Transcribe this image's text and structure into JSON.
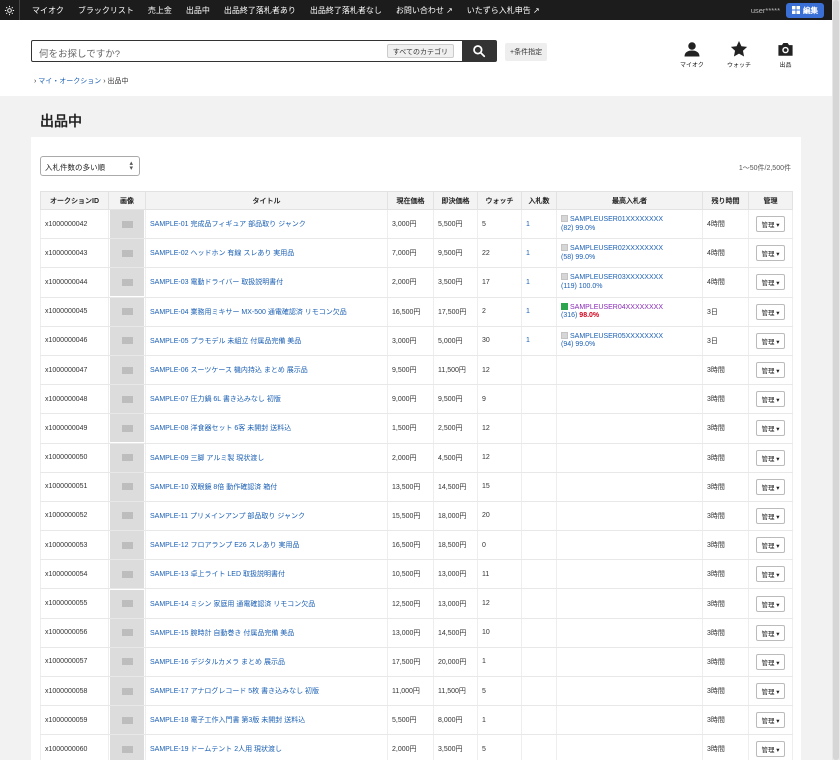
{
  "topbar": {
    "nav": [
      "マイオク",
      "ブラックリスト",
      "売上金",
      "出品中",
      "出品終了落札者あり",
      "出品終了落札者なし",
      "お問い合わせ ↗",
      "いたずら入札申告 ↗"
    ],
    "user": "user*****",
    "edit_label": "編集"
  },
  "search": {
    "placeholder": "何をお探しですか?",
    "category": "すべてのカテゴリ",
    "filter_label": "+条件指定"
  },
  "header_icons": [
    {
      "label": "マイオク",
      "icon": "user-icon"
    },
    {
      "label": "ウォッチ",
      "icon": "star-icon"
    },
    {
      "label": "出品",
      "icon": "camera-icon"
    }
  ],
  "breadcrumb": {
    "parent": "マイ・オークション",
    "sep": "›",
    "current": "出品中"
  },
  "page_title": "出品中",
  "sort_label": "入札件数の多い順",
  "count_label": "1〜50件/2,500件",
  "columns": [
    "オークションID",
    "画像",
    "タイトル",
    "現在価格",
    "即決価格",
    "ウォッチ",
    "入札数",
    "最高入札者",
    "残り時間",
    "管理"
  ],
  "manage_label": "管理 ▾",
  "rows": [
    {
      "id": "x1000000042",
      "title": "SAMPLE-01 完成品フィギュア 部品取り ジャンク",
      "price": "3,000円",
      "buyout": "5,500円",
      "watch": "5",
      "bids": "1",
      "bidder": "SAMPLEUSER01XXXXXXXX",
      "rating": "(82) 99.0%",
      "checked": false,
      "time": "4時間"
    },
    {
      "id": "x1000000043",
      "title": "SAMPLE-02 ヘッドホン 有線 スレあり 実用品",
      "price": "7,000円",
      "buyout": "9,500円",
      "watch": "22",
      "bids": "1",
      "bidder": "SAMPLEUSER02XXXXXXXX",
      "rating": "(58) 99.0%",
      "checked": false,
      "time": "4時間"
    },
    {
      "id": "x1000000044",
      "title": "SAMPLE-03 電動ドライバー 取扱説明書付",
      "price": "2,000円",
      "buyout": "3,500円",
      "watch": "17",
      "bids": "1",
      "bidder": "SAMPLEUSER03XXXXXXXX",
      "rating": "(119) 100.0%",
      "checked": false,
      "time": "4時間"
    },
    {
      "id": "x1000000045",
      "title": "SAMPLE-04 業務用ミキサー MX-500 通電確認済 リモコン欠品",
      "price": "16,500円",
      "buyout": "17,500円",
      "watch": "2",
      "bids": "1",
      "bidder": "SAMPLEUSER04XXXXXXXX",
      "rating": "(316) ",
      "rating_hot": "98.0%",
      "checked": true,
      "time": "3日"
    },
    {
      "id": "x1000000046",
      "title": "SAMPLE-05 プラモデル 未組立 付属品完備 美品",
      "price": "3,000円",
      "buyout": "5,000円",
      "watch": "30",
      "bids": "1",
      "bidder": "SAMPLEUSER05XXXXXXXX",
      "rating": "(94) 99.0%",
      "checked": false,
      "time": "3日"
    },
    {
      "id": "x1000000047",
      "title": "SAMPLE-06 スーツケース 機内持込 まとめ 展示品",
      "price": "9,500円",
      "buyout": "11,500円",
      "watch": "12",
      "bids": "",
      "time": "3時間"
    },
    {
      "id": "x1000000048",
      "title": "SAMPLE-07 圧力鍋 6L 書き込みなし 初版",
      "price": "9,000円",
      "buyout": "9,500円",
      "watch": "9",
      "bids": "",
      "time": "3時間"
    },
    {
      "id": "x1000000049",
      "title": "SAMPLE-08 洋食器セット 6客 未開封 送料込",
      "price": "1,500円",
      "buyout": "2,500円",
      "watch": "12",
      "bids": "",
      "time": "3時間"
    },
    {
      "id": "x1000000050",
      "title": "SAMPLE-09 三脚 アルミ製 現状渡し",
      "price": "2,000円",
      "buyout": "4,500円",
      "watch": "12",
      "bids": "",
      "time": "3時間"
    },
    {
      "id": "x1000000051",
      "title": "SAMPLE-10 双眼鏡 8倍 動作確認済 箱付",
      "price": "13,500円",
      "buyout": "14,500円",
      "watch": "15",
      "bids": "",
      "time": "3時間"
    },
    {
      "id": "x1000000052",
      "title": "SAMPLE-11 プリメインアンプ 部品取り ジャンク",
      "price": "15,500円",
      "buyout": "18,000円",
      "watch": "20",
      "bids": "",
      "time": "3時間"
    },
    {
      "id": "x1000000053",
      "title": "SAMPLE-12 フロアランプ E26 スレあり 実用品",
      "price": "16,500円",
      "buyout": "18,500円",
      "watch": "0",
      "bids": "",
      "time": "3時間"
    },
    {
      "id": "x1000000054",
      "title": "SAMPLE-13 卓上ライト LED 取扱説明書付",
      "price": "10,500円",
      "buyout": "13,000円",
      "watch": "11",
      "bids": "",
      "time": "3時間"
    },
    {
      "id": "x1000000055",
      "title": "SAMPLE-14 ミシン 家庭用 通電確認済 リモコン欠品",
      "price": "12,500円",
      "buyout": "13,000円",
      "watch": "12",
      "bids": "",
      "time": "3時間"
    },
    {
      "id": "x1000000056",
      "title": "SAMPLE-15 腕時計 自動巻き 付属品完備 美品",
      "price": "13,000円",
      "buyout": "14,500円",
      "watch": "10",
      "bids": "",
      "time": "3時間"
    },
    {
      "id": "x1000000057",
      "title": "SAMPLE-16 デジタルカメラ まとめ 展示品",
      "price": "17,500円",
      "buyout": "20,000円",
      "watch": "1",
      "bids": "",
      "time": "3時間"
    },
    {
      "id": "x1000000058",
      "title": "SAMPLE-17 アナログレコード 5枚 書き込みなし 初版",
      "price": "11,000円",
      "buyout": "11,500円",
      "watch": "5",
      "bids": "",
      "time": "3時間"
    },
    {
      "id": "x1000000059",
      "title": "SAMPLE-18 電子工作入門書 第3版 未開封 送料込",
      "price": "5,500円",
      "buyout": "8,000円",
      "watch": "1",
      "bids": "",
      "time": "3時間"
    },
    {
      "id": "x1000000060",
      "title": "SAMPLE-19 ドームテント 2人用 現状渡し",
      "price": "2,000円",
      "buyout": "3,500円",
      "watch": "5",
      "bids": "",
      "time": "3時間"
    }
  ]
}
